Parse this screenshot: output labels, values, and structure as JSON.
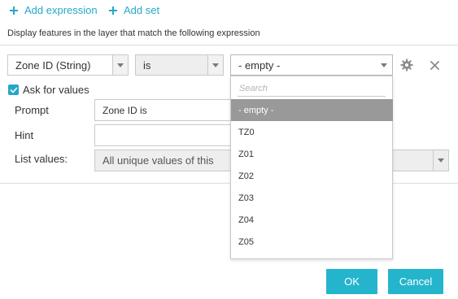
{
  "toolbar": {
    "add_expression": "Add expression",
    "add_set": "Add set"
  },
  "description": "Display features in the layer that match the following expression",
  "expression": {
    "field": "Zone ID (String)",
    "operator": "is",
    "value": "- empty -"
  },
  "ask_for_values": {
    "checked": true,
    "label": "Ask for values"
  },
  "form": {
    "prompt_label": "Prompt",
    "prompt_value": "Zone ID is",
    "hint_label": "Hint",
    "hint_value": "",
    "list_values_label": "List values:",
    "list_values_selected": "All unique values of this"
  },
  "dropdown": {
    "search_placeholder": "Search",
    "options": [
      "- empty -",
      "TZ0",
      "Z01",
      "Z02",
      "Z03",
      "Z04",
      "Z05"
    ],
    "selected_index": 0
  },
  "footer": {
    "ok": "OK",
    "cancel": "Cancel"
  },
  "colors": {
    "accent": "#24a8c8",
    "button": "#24b5cc",
    "selected_option": "#999999"
  },
  "icons": [
    "plus-icon",
    "gear-icon",
    "close-icon",
    "check-icon",
    "chevron-down-icon"
  ]
}
